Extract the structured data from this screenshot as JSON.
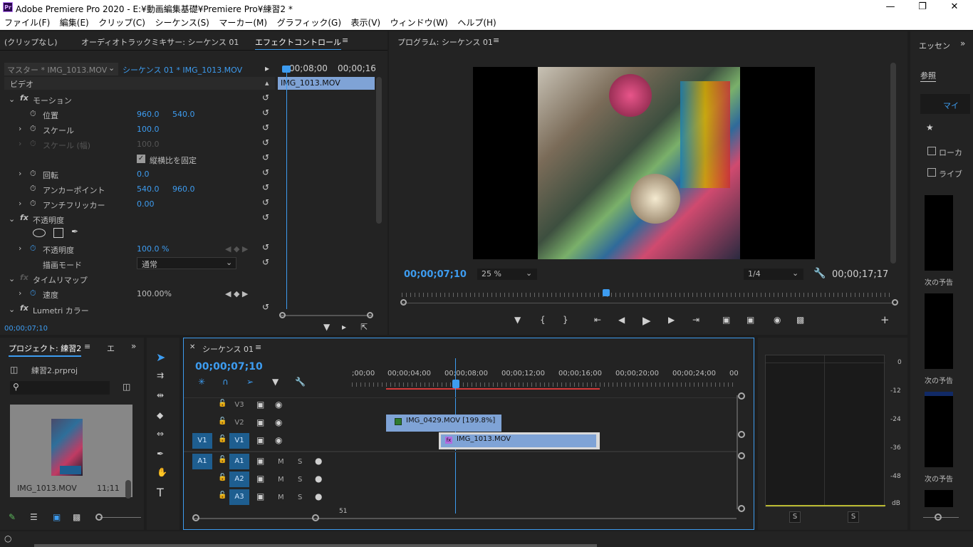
{
  "app": {
    "title": "Adobe Premiere Pro 2020 - E:¥動画編集基礎¥Premiere Pro¥練習2 *",
    "logo": "Pr"
  },
  "menu": [
    "ファイル(F)",
    "編集(E)",
    "クリップ(C)",
    "シーケンス(S)",
    "マーカー(M)",
    "グラフィック(G)",
    "表示(V)",
    "ウィンドウ(W)",
    "ヘルプ(H)"
  ],
  "effect_panel": {
    "tabs": [
      "(クリップなし)",
      "オーディオトラックミキサー: シーケンス 01",
      "エフェクトコントロール"
    ],
    "master": "マスター * IMG_1013.MOV",
    "sequence": "シーケンス 01 * IMG_1013.MOV",
    "time_start": "00;08;00",
    "time_end": "00;00;16",
    "clip_name": "IMG_1013.MOV",
    "section_video": "ビデオ",
    "motion": "モーション",
    "position_label": "位置",
    "position_x": "960.0",
    "position_y": "540.0",
    "scale_label": "スケール",
    "scale_val": "100.0",
    "scale_w_label": "スケール (幅)",
    "scale_w_val": "100.0",
    "uniform_label": "縦横比を固定",
    "rotation_label": "回転",
    "rotation_val": "0.0",
    "anchor_label": "アンカーポイント",
    "anchor_x": "540.0",
    "anchor_y": "960.0",
    "flicker_label": "アンチフリッカー",
    "flicker_val": "0.00",
    "opacity_section": "不透明度",
    "opacity_label": "不透明度",
    "opacity_val": "100.0 %",
    "blend_label": "描画モード",
    "blend_val": "通常",
    "timeremap": "タイムリマップ",
    "speed_label": "速度",
    "speed_val": "100.00%",
    "lumetri": "Lumetri カラー",
    "current_time": "00;00;07;10"
  },
  "program": {
    "title": "プログラム: シーケンス 01",
    "timecode": "00;00;07;10",
    "zoom": "25 %",
    "quality": "1/4",
    "duration": "00;00;17;17"
  },
  "essential": {
    "tab": "エッセン",
    "browse": "参照",
    "my": "マイ",
    "local": "ローカ",
    "live": "ライブ",
    "next1": "次の予告",
    "next2": "次の予告",
    "next3": "次の予告"
  },
  "project": {
    "title": "プロジェクト: 練習2",
    "tab2": "エ",
    "file": "練習2.prproj",
    "clip_name": "IMG_1013.MOV",
    "clip_dur": "11;11"
  },
  "timeline": {
    "title": "シーケンス 01",
    "timecode": "00;00;07;10",
    "ruler": [
      ";00;00",
      "00;00;04;00",
      "00;00;08;00",
      "00;00;12;00",
      "00;00;16;00",
      "00;00;20;00",
      "00;00;24;00",
      "00"
    ],
    "tracks": [
      {
        "src": "",
        "name": "V3"
      },
      {
        "src": "",
        "name": "V2"
      },
      {
        "src": "V1",
        "name": "V1"
      },
      {
        "src": "A1",
        "name": "A1"
      },
      {
        "src": "",
        "name": "A2"
      },
      {
        "src": "",
        "name": "A3"
      }
    ],
    "clip1": "IMG_0429.MOV [199.8%]",
    "clip2": "IMG_1013.MOV",
    "bottom_num": "51"
  },
  "meter": {
    "scale": [
      "0",
      "-12",
      "-24",
      "-36",
      "-48",
      "dB"
    ],
    "solo": "S"
  }
}
